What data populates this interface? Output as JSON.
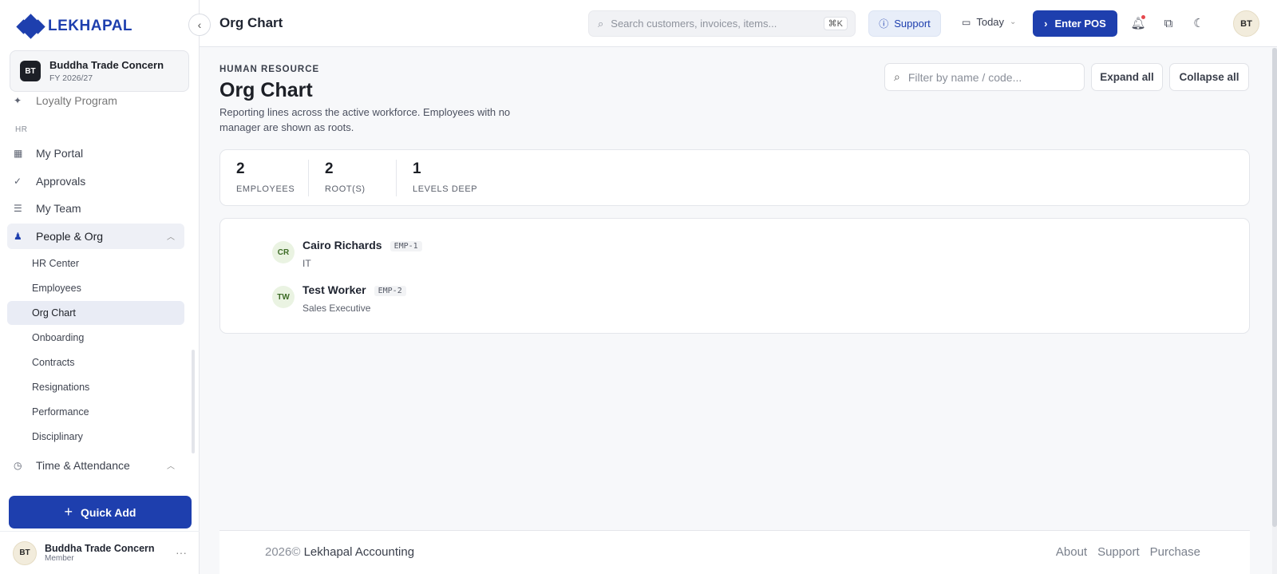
{
  "brand": {
    "name": "LEKHAPAL"
  },
  "company": {
    "badge": "BT",
    "name": "Buddha Trade Concern",
    "fy": "FY 2026/27"
  },
  "sidebar": {
    "partial_item": "Loyalty Program",
    "section_hr": "HR",
    "items": [
      {
        "label": "My Portal",
        "icon": "portal-icon"
      },
      {
        "label": "Approvals",
        "icon": "approvals-icon"
      },
      {
        "label": "My Team",
        "icon": "team-icon"
      },
      {
        "label": "People & Org",
        "icon": "people-icon"
      }
    ],
    "sub_items": [
      "HR Center",
      "Employees",
      "Org Chart",
      "Onboarding",
      "Contracts",
      "Resignations",
      "Performance",
      "Disciplinary"
    ],
    "time_attendance": "Time & Attendance",
    "quick_add": "Quick Add",
    "user": {
      "initials": "BT",
      "name": "Buddha Trade Concern",
      "role": "Member"
    }
  },
  "topbar": {
    "title": "Org Chart",
    "search_placeholder": "Search customers, invoices, items...",
    "search_shortcut": "⌘K",
    "support": "Support",
    "date_filter": "Today",
    "enter_pos": "Enter POS",
    "avatar": "BT"
  },
  "page": {
    "eyebrow": "HUMAN RESOURCE",
    "title": "Org Chart",
    "description": "Reporting lines across the active workforce. Employees with no manager are shown as roots.",
    "filter_placeholder": "Filter by name / code...",
    "expand_all": "Expand all",
    "collapse_all": "Collapse all"
  },
  "stats": [
    {
      "value": "2",
      "label": "EMPLOYEES"
    },
    {
      "value": "2",
      "label": "ROOT(S)"
    },
    {
      "value": "1",
      "label": "LEVELS DEEP"
    }
  ],
  "employees": [
    {
      "initials": "CR",
      "name": "Cairo Richards",
      "code": "EMP-1",
      "dept": "IT"
    },
    {
      "initials": "TW",
      "name": "Test Worker",
      "code": "EMP-2",
      "dept": "Sales Executive"
    }
  ],
  "footer": {
    "year": "2026©",
    "product": "Lekhapal Accounting",
    "links": [
      "About",
      "Support",
      "Purchase"
    ]
  }
}
